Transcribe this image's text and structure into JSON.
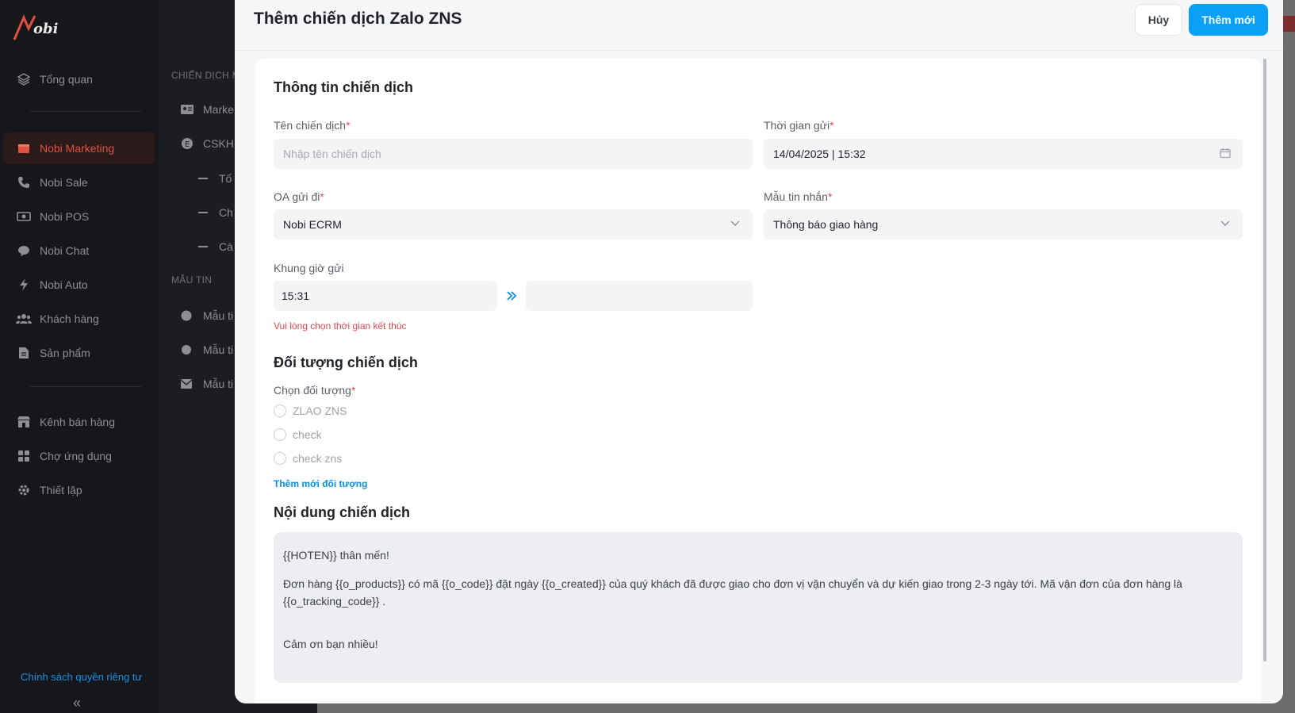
{
  "sidebar": {
    "items": [
      {
        "label": "Tổng quan",
        "icon": "layers-icon"
      },
      {
        "label": "Nobi Marketing",
        "icon": "store-icon"
      },
      {
        "label": "Nobi Sale",
        "icon": "phone-icon"
      },
      {
        "label": "Nobi POS",
        "icon": "cash-icon"
      },
      {
        "label": "Nobi Chat",
        "icon": "chat-icon"
      },
      {
        "label": "Nobi Auto",
        "icon": "bolt-icon"
      },
      {
        "label": "Khách hàng",
        "icon": "users-icon"
      },
      {
        "label": "Sản phẩm",
        "icon": "document-icon"
      },
      {
        "label": "Kênh bán hàng",
        "icon": "shop-icon"
      },
      {
        "label": "Chợ ứng dụng",
        "icon": "apps-icon"
      },
      {
        "label": "Thiết lập",
        "icon": "gear-icon"
      }
    ],
    "privacy_link": "Chính sách quyền riêng tư",
    "accent": "#e0523e"
  },
  "subpanel": {
    "group1": "CHIẾN DỊCH M",
    "items1": [
      "Marke",
      "CSKH"
    ],
    "dash_items": [
      "Tố",
      "Ch",
      "Cà"
    ],
    "group2": "MẪU TIN",
    "items2": [
      "Mẫu ti",
      "Mẫu ti",
      "Mẫu ti"
    ]
  },
  "modal": {
    "title": "Thêm chiến dịch Zalo ZNS",
    "cancel_label": "Hủy",
    "submit_label": "Thêm mới",
    "primary_color": "#0aa0f5",
    "info": {
      "section_title": "Thông tin chiến dịch",
      "name_label": "Tên chiến dịch",
      "name_placeholder": "Nhập tên chiến dịch",
      "time_label": "Thời gian gửi",
      "time_value": "14/04/2025 | 15:32",
      "oa_label": "OA gửi đi",
      "oa_value": "Nobi ECRM",
      "template_label": "Mẫu tin nhắn",
      "template_value": "Thông báo giao hàng",
      "window_label": "Khung giờ gửi",
      "window_start": "15:31",
      "window_end": "",
      "window_error": "Vui lòng chọn thời gian kết thúc",
      "required_mark": "*"
    },
    "audience": {
      "section_title": "Đối tượng chiến dịch",
      "choose_label": "Chọn đối tượng",
      "options": [
        "ZLAO ZNS",
        "check",
        "check zns"
      ],
      "add_link": "Thêm mới đối tượng"
    },
    "content": {
      "section_title": "Nội dung chiến dịch",
      "lines": [
        "{{HOTEN}} thân mến!",
        "Đơn hàng {{o_products}} có mã {{o_code}} đặt ngày {{o_created}} của quý khách đã được giao cho đơn vị vận chuyển và dự kiến giao trong 2-3 ngày tới. Mã vận đơn của đơn hàng là {{o_tracking_code}} .",
        "Cảm ơn bạn nhiều!"
      ]
    }
  }
}
